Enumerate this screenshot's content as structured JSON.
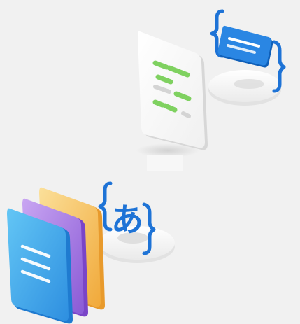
{
  "illustrations": {
    "json_document": {
      "icon": "json-document-icon",
      "accent_color": "#6cc04a",
      "brace_color": "#1e73d6"
    },
    "localization_files": {
      "icon": "localization-files-icon",
      "glyph": "あ",
      "brace_color": "#1e73d6",
      "layer_colors": [
        "#f5b84a",
        "#a77be0",
        "#3aa3e8"
      ]
    }
  }
}
